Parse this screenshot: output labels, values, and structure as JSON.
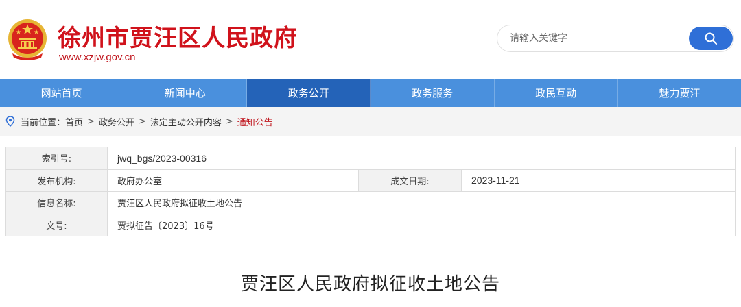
{
  "header": {
    "site_title": "徐州市贾汪区人民政府",
    "site_url": "www.xzjw.gov.cn",
    "emblem_icon": "national-emblem-icon",
    "search": {
      "placeholder": "请输入关键字",
      "icon": "search-icon"
    }
  },
  "nav": {
    "items": [
      {
        "label": "网站首页"
      },
      {
        "label": "新闻中心"
      },
      {
        "label": "政务公开"
      },
      {
        "label": "政务服务"
      },
      {
        "label": "政民互动"
      },
      {
        "label": "魅力贾汪"
      }
    ],
    "active_index": 2
  },
  "breadcrumb": {
    "prefix": "当前位置：",
    "items": [
      "首页",
      "政务公开",
      "法定主动公开内容",
      "通知公告"
    ],
    "separator": ">",
    "icon": "location-pin-icon"
  },
  "info": {
    "index_label": "索引号:",
    "index_value": "jwq_bgs/2023-00316",
    "publisher_label": "发布机构:",
    "publisher_value": "政府办公室",
    "date_label": "成文日期:",
    "date_value": "2023-11-21",
    "name_label": "信息名称:",
    "name_value": "贾汪区人民政府拟征收土地公告",
    "doc_label": "文号:",
    "doc_value": "贾拟征告〔2023〕16号"
  },
  "article": {
    "title": "贾汪区人民政府拟征收土地公告"
  },
  "colors": {
    "brand_red": "#d0121b",
    "nav_blue": "#4a90dd",
    "nav_active": "#2463b8",
    "search_button": "#2f6fd7"
  }
}
